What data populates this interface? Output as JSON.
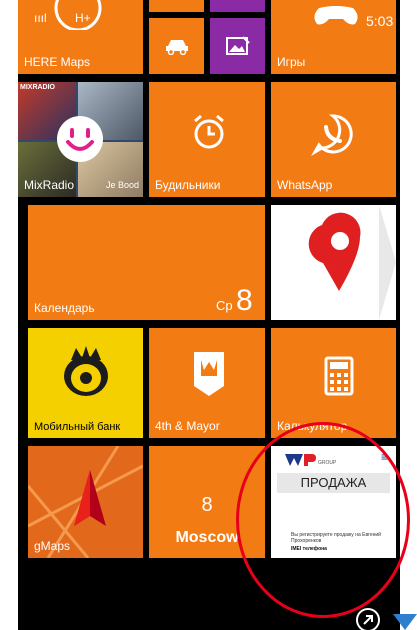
{
  "status": {
    "signal": "ıııl",
    "network": "H+",
    "time": "5:03"
  },
  "tiles": {
    "here_maps": "HERE Maps",
    "games": "Игры",
    "mixradio": "MixRadio",
    "alarms": "Будильники",
    "whatsapp": "WhatsApp",
    "calendar": "Календарь",
    "calendar_day": "Ср",
    "calendar_date": "8",
    "mobile_bank": "Мобильный банк",
    "foursquare": "4th & Mayor",
    "calculator": "Калькулятор",
    "gmaps": "gMaps",
    "weather_temp": "8",
    "weather_city": "Moscow",
    "wp_brand": "WP",
    "wp_group": "GROUP",
    "wp_menu": "≡",
    "wp_heading": "ПРОДАЖА",
    "wp_text": "Вы регистрируете продажу на Евгений Прохоренков",
    "wp_subtext": "IMEI телефона",
    "mixradio_art1": "MIXRADIO",
    "mixradio_art2": "Je Bood"
  },
  "colors": {
    "accent": "#f37b13",
    "purple": "#8a2aa5",
    "yellow": "#f5d000",
    "highlight": "#e8001a",
    "scroll": "#2f7fd0"
  }
}
